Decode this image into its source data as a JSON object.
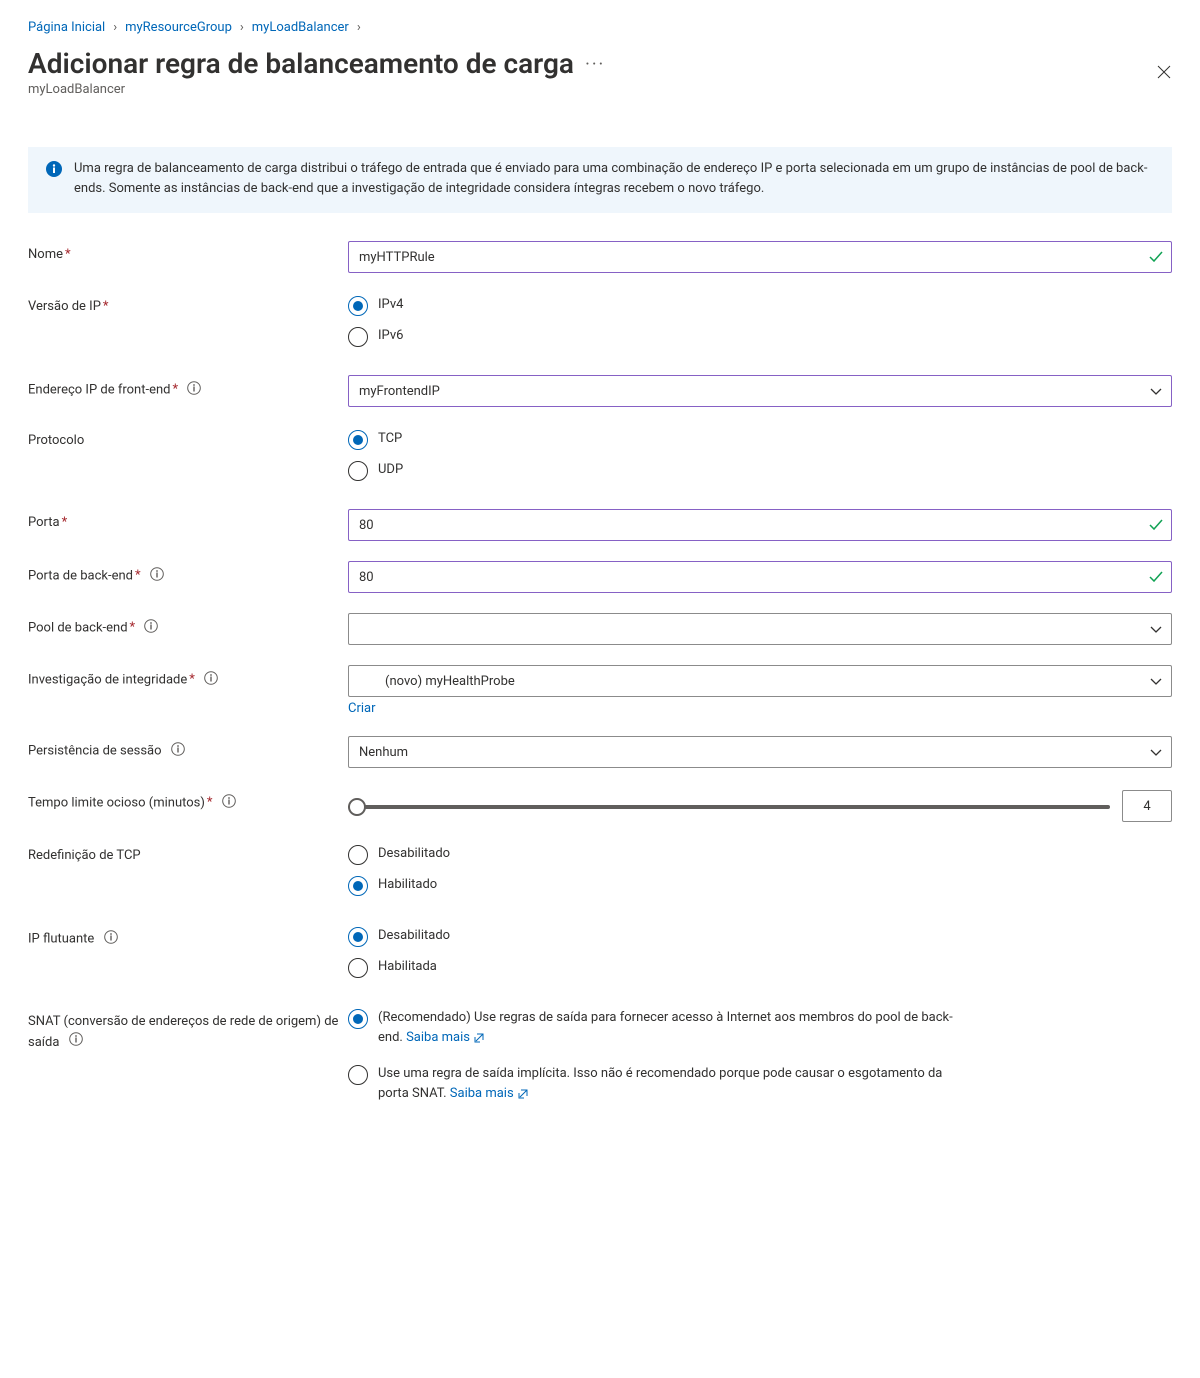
{
  "breadcrumb": {
    "items": [
      "Página Inicial",
      "myResourceGroup",
      "myLoadBalancer"
    ]
  },
  "header": {
    "title": "Adicionar regra de balanceamento de carga",
    "subtitle": "myLoadBalancer"
  },
  "infobox": {
    "text": "Uma regra de balanceamento de carga distribui o tráfego de entrada que é enviado para uma combinação de endereço IP e porta selecionada em um grupo de instâncias de pool de back-ends. Somente as instâncias de back-end que a investigação de integridade considera íntegras recebem o novo tráfego."
  },
  "form": {
    "name": {
      "label": "Nome",
      "value": "myHTTPRule"
    },
    "ipversion": {
      "label": "Versão de IP",
      "options": [
        "IPv4",
        "IPv6"
      ],
      "selected": 0
    },
    "frontend": {
      "label": "Endereço IP de front-end",
      "value": "myFrontendIP"
    },
    "protocol": {
      "label": "Protocolo",
      "options": [
        "TCP",
        "UDP"
      ],
      "selected": 0
    },
    "port": {
      "label": "Porta",
      "value": "80"
    },
    "backendport": {
      "label": "Porta de back-end",
      "value": "80"
    },
    "backendpool": {
      "label": "Pool de back-end",
      "value": ""
    },
    "probe": {
      "label": "Investigação de integridade",
      "value": "(novo) myHealthProbe",
      "create_link": "Criar"
    },
    "session": {
      "label": "Persistência de sessão",
      "value": "Nenhum"
    },
    "idle": {
      "label": "Tempo limite ocioso (minutos)",
      "value": "4"
    },
    "tcpreset": {
      "label": "Redefinição de TCP",
      "options": [
        "Desabilitado",
        "Habilitado"
      ],
      "selected": 1
    },
    "floatingip": {
      "label": "IP flutuante",
      "options": [
        "Desabilitado",
        "Habilitada"
      ],
      "selected": 0
    },
    "snat": {
      "label": "SNAT (conversão de endereços de rede de origem) de saída",
      "options": [
        {
          "text": "(Recomendado) Use regras de saída para fornecer acesso à Internet aos membros do pool de back-end. ",
          "link": "Saiba mais"
        },
        {
          "text": "Use uma regra de saída implícita. Isso não é recomendado porque pode causar o esgotamento da porta SNAT. ",
          "link": "Saiba mais"
        }
      ],
      "selected": 0
    }
  }
}
